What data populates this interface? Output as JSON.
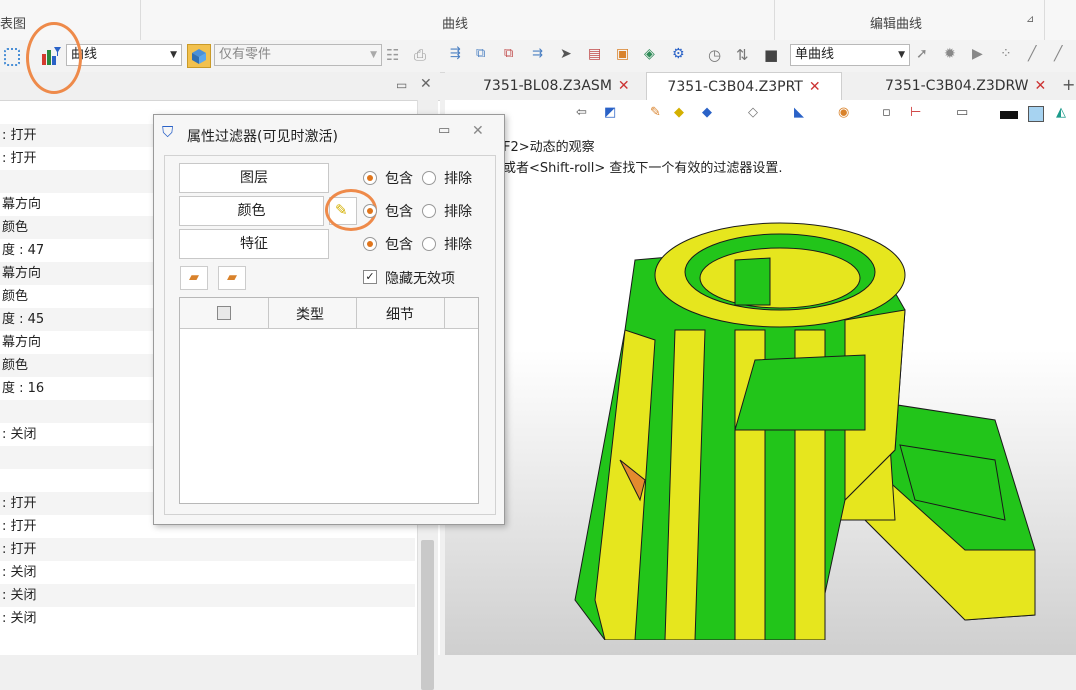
{
  "ribbon": {
    "left_label": "表图",
    "curves_label": "曲线",
    "edit_curves_label": "编辑曲线"
  },
  "toolbar": {
    "filter_combo": "曲线",
    "scope_combo": "仅有零件",
    "curve_type_combo": "单曲线"
  },
  "left_panel": {
    "rows": [
      {
        "text": ": 打开"
      },
      {
        "text": ": 打开"
      },
      {
        "text": ""
      },
      {
        "text": "幕方向"
      },
      {
        "text": "颜色"
      },
      {
        "text": "度 : 47"
      },
      {
        "text": "幕方向"
      },
      {
        "text": "颜色"
      },
      {
        "text": "度 : 45"
      },
      {
        "text": "幕方向"
      },
      {
        "text": "颜色"
      },
      {
        "text": "度 : 16"
      },
      {
        "text": ""
      },
      {
        "text": ": 关闭"
      },
      {
        "text": ""
      },
      {
        "text": ""
      },
      {
        "text": ": 打开"
      },
      {
        "text": ": 打开"
      },
      {
        "text": ": 打开"
      },
      {
        "text": ": 关闭"
      },
      {
        "text": ": 关闭"
      },
      {
        "text": ": 关闭"
      }
    ]
  },
  "tabs": [
    {
      "label": "7351-BL08.Z3ASM",
      "active": false
    },
    {
      "label": "7351-C3B04.Z3PRT",
      "active": true
    },
    {
      "label": "7351-C3B04.Z3DRW",
      "active": false
    }
  ],
  "viewport": {
    "hint1": "F2>动态的观察",
    "hint2": "或者<Shift-roll> 查找下一个有效的过滤器设置."
  },
  "dialog": {
    "title": "属性过滤器(可见时激活)",
    "filters": [
      {
        "label": "图层",
        "mode": "包含",
        "include_label": "包含",
        "exclude_label": "排除"
      },
      {
        "label": "颜色",
        "mode": "包含",
        "include_label": "包含",
        "exclude_label": "排除"
      },
      {
        "label": "特征",
        "mode": "包含",
        "include_label": "包含",
        "exclude_label": "排除"
      }
    ],
    "hide_invalid_label": "隐藏无效项",
    "hide_invalid_checked": true,
    "table_headers": {
      "type": "类型",
      "detail": "细节"
    }
  },
  "colors": {
    "accent": "#e0751c",
    "highlight_ring": "#ee8a4a",
    "part_green": "#22c51a",
    "part_yellow": "#e6e61e"
  }
}
